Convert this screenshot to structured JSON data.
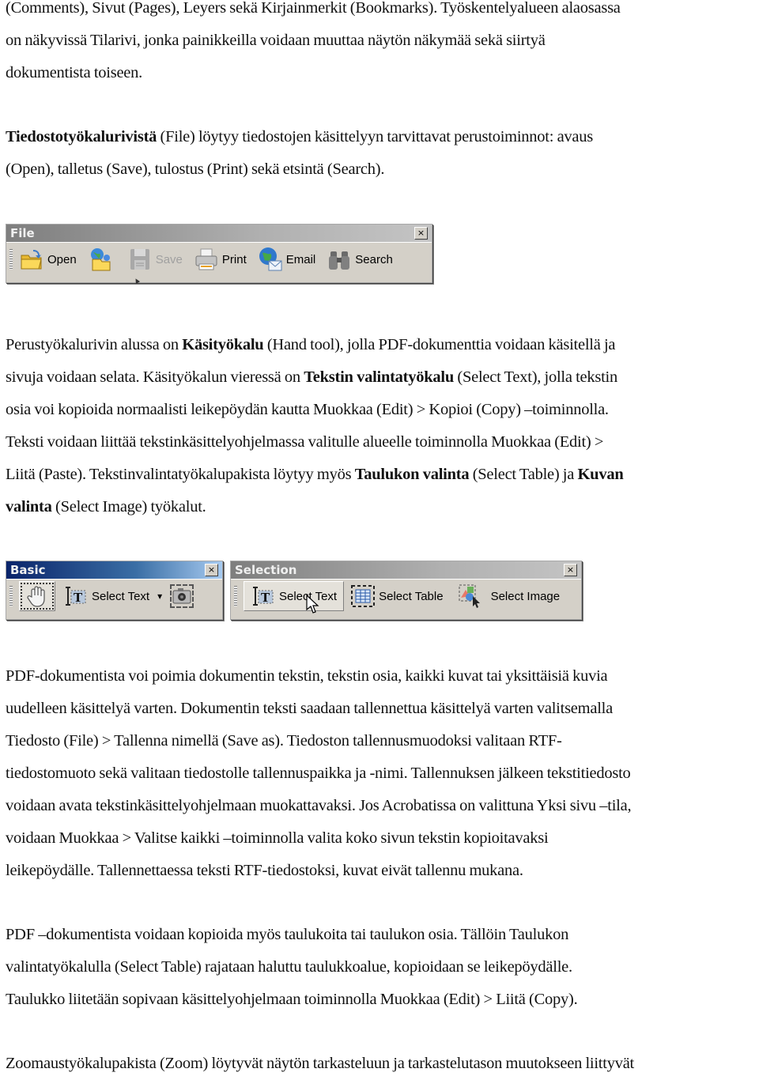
{
  "paragraphs": {
    "p1": {
      "lines": [
        "(Comments), Sivut (Pages), Leyers sekä Kirjainmerkit (Bookmarks). Työskentelyalueen alaosassa",
        "on näkyvissä Tilarivi, jonka painikkeilla voidaan muuttaa näytön näkymää sekä siirtyä",
        "dokumentista toiseen."
      ]
    },
    "p2": {
      "line1_bold": "Tiedostotyökalurivistä",
      "line1_rest": " (File) löytyy tiedostojen käsittelyyn tarvittavat perustoiminnot: avaus",
      "line2": "(Open), talletus (Save), tulostus (Print) sekä etsintä (Search)."
    },
    "p3": {
      "l1_a": "Perustyökalurivin alussa on ",
      "l1_b": "Käsityökalu",
      "l1_c": " (Hand tool), jolla PDF-dokumenttia voidaan käsitellä ja",
      "l2_a": "sivuja voidaan selata. Käsityökalun vieressä on ",
      "l2_b": "Tekstin valintatyökalu",
      "l2_c": " (Select Text), jolla tekstin",
      "l3": "osia voi kopioida normaalisti leikepöydän kautta Muokkaa (Edit)  > Kopioi (Copy) –toiminnolla.",
      "l4": "Teksti voidaan liittää tekstinkäsittelyohjelmassa valitulle alueelle toiminnolla Muokkaa (Edit)  >",
      "l5_a": "Liitä (Paste). Tekstinvalintatyökalupakista löytyy myös ",
      "l5_b": "Taulukon valinta",
      "l5_c": " (Select Table) ja ",
      "l5_d": "Kuvan",
      "l6_a": "valinta",
      "l6_b": " (Select Image) työkalut."
    },
    "p4": {
      "lines": [
        "PDF-dokumentista voi poimia dokumentin tekstin, tekstin osia, kaikki kuvat tai yksittäisiä kuvia",
        "uudelleen käsittelyä varten. Dokumentin teksti saadaan tallennettua käsittelyä varten valitsemalla",
        "Tiedosto (File) > Tallenna nimellä (Save as). Tiedoston tallennusmuodoksi valitaan RTF-",
        "tiedostomuoto sekä valitaan tiedostolle tallennuspaikka ja -nimi. Tallennuksen jälkeen tekstitiedosto",
        "voidaan avata tekstinkäsittelyohjelmaan muokattavaksi. Jos Acrobatissa on valittuna Yksi sivu –tila,",
        "voidaan Muokkaa > Valitse kaikki –toiminnolla valita koko sivun tekstin kopioitavaksi",
        "leikepöydälle. Tallennettaessa teksti RTF-tiedostoksi, kuvat eivät tallennu mukana."
      ]
    },
    "p5": {
      "lines": [
        "PDF –dokumentista voidaan kopioida myös taulukoita tai taulukon osia. Tällöin Taulukon",
        "valintatyökalulla (Select Table) rajataan haluttu taulukkoalue, kopioidaan se leikepöydälle.",
        "Taulukko liitetään sopivaan käsittelyohjelmaan toiminnolla Muokkaa (Edit) > Liitä (Copy)."
      ]
    },
    "p6": {
      "lines": [
        "Zoomaustyökalupakista (Zoom) löytyvät näytön tarkasteluun ja tarkastelutason muutokseen liittyvät"
      ]
    }
  },
  "toolbars": {
    "file": {
      "title": "File",
      "close": "×",
      "buttons": [
        {
          "label": "Open",
          "icon": "folder-open-icon"
        },
        {
          "label": "",
          "icon": "folder-web-icon"
        },
        {
          "label": "Save",
          "icon": "floppy-disk-icon",
          "disabled": true
        },
        {
          "label": "Print",
          "icon": "printer-icon"
        },
        {
          "label": "Email",
          "icon": "globe-envelope-icon"
        },
        {
          "label": "Search",
          "icon": "binoculars-icon"
        }
      ]
    },
    "basic": {
      "title": "Basic",
      "close": "×",
      "buttons": [
        {
          "label": "",
          "icon": "hand-icon",
          "selected": true
        },
        {
          "label": "Select Text",
          "icon": "select-text-icon"
        },
        {
          "label": "▾",
          "icon": "dropdown-arrow-icon"
        },
        {
          "label": "",
          "icon": "snapshot-camera-icon"
        }
      ]
    },
    "selection": {
      "title": "Selection",
      "close": "×",
      "buttons": [
        {
          "label": "Select Text",
          "icon": "select-text-icon",
          "pressed": true
        },
        {
          "label": "Select Table",
          "icon": "select-table-icon"
        },
        {
          "label": "Select Image",
          "icon": "select-image-icon"
        }
      ]
    }
  },
  "colors": {
    "toolbar_bg": "#d4d0c8",
    "title_inactive": "#8a8a8a",
    "title_active": "#0a246a"
  }
}
